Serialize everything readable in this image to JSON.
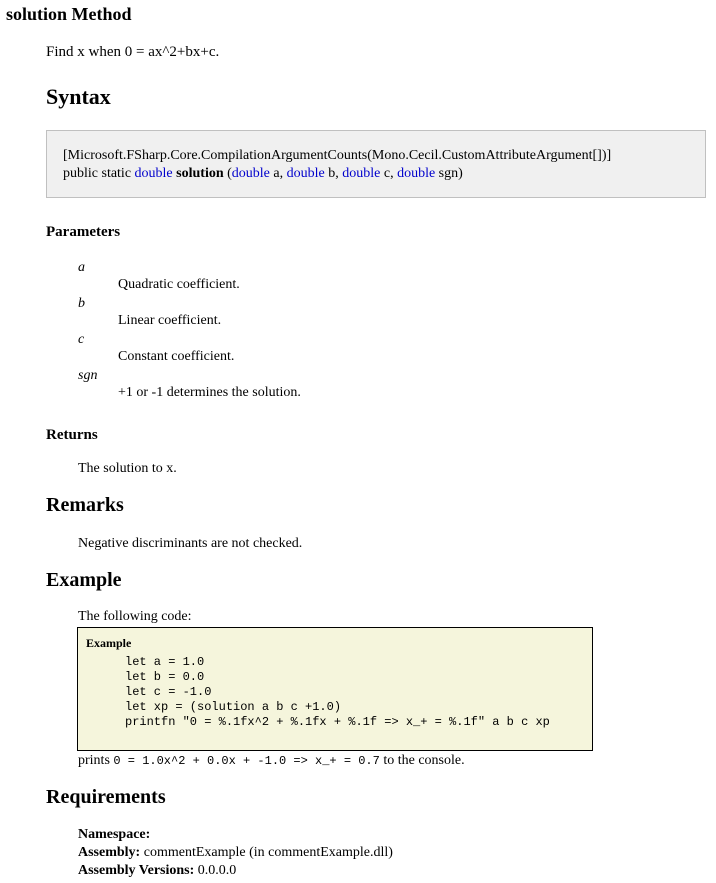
{
  "page": {
    "title": "solution Method",
    "summary": "Find x when 0 = ax^2+bx+c."
  },
  "syntax": {
    "heading": "Syntax",
    "attribute_line": "[Microsoft.FSharp.Core.CompilationArgumentCounts(Mono.Cecil.CustomAttributeArgument[])]",
    "modifiers": "public static",
    "return_type": "double",
    "method_name": "solution",
    "open_paren": "(",
    "params": [
      {
        "type": "double",
        "name": "a",
        "sep": ","
      },
      {
        "type": "double",
        "name": "b",
        "sep": ","
      },
      {
        "type": "double",
        "name": "c",
        "sep": ","
      },
      {
        "type": "double",
        "name": "sgn",
        "sep": ")"
      }
    ]
  },
  "parameters": {
    "heading": "Parameters",
    "items": [
      {
        "name": "a",
        "description": "Quadratic coefficient."
      },
      {
        "name": "b",
        "description": "Linear coefficient."
      },
      {
        "name": "c",
        "description": "Constant coefficient."
      },
      {
        "name": "sgn",
        "description": "+1 or -1 determines the solution."
      }
    ]
  },
  "returns": {
    "heading": "Returns",
    "text": "The solution to x."
  },
  "remarks": {
    "heading": "Remarks",
    "text": "Negative discriminants are not checked."
  },
  "example": {
    "heading": "Example",
    "intro": "The following code:",
    "box_title": "Example",
    "code_lines": [
      "let a = 1.0",
      "let b = 0.0",
      "let c = -1.0",
      "let xp = (solution a b c +1.0)",
      "printfn \"0 = %.1fx^2 + %.1fx + %.1f => x_+ = %.1f\" a b c xp"
    ],
    "prints_prefix": "prints",
    "prints_output": "0 = 1.0x^2 + 0.0x + -1.0 => x_+ = 0.7",
    "prints_suffix": "to the console."
  },
  "requirements": {
    "heading": "Requirements",
    "namespace_label": "Namespace:",
    "namespace_value": "",
    "assembly_label": "Assembly:",
    "assembly_value": "commentExample (in commentExample.dll)",
    "versions_label": "Assembly Versions:",
    "versions_value": "0.0.0.0"
  },
  "colors": {
    "keyword": "#0000cc",
    "syntax_background": "#f0f0f0",
    "example_background": "#f5f5dc"
  }
}
